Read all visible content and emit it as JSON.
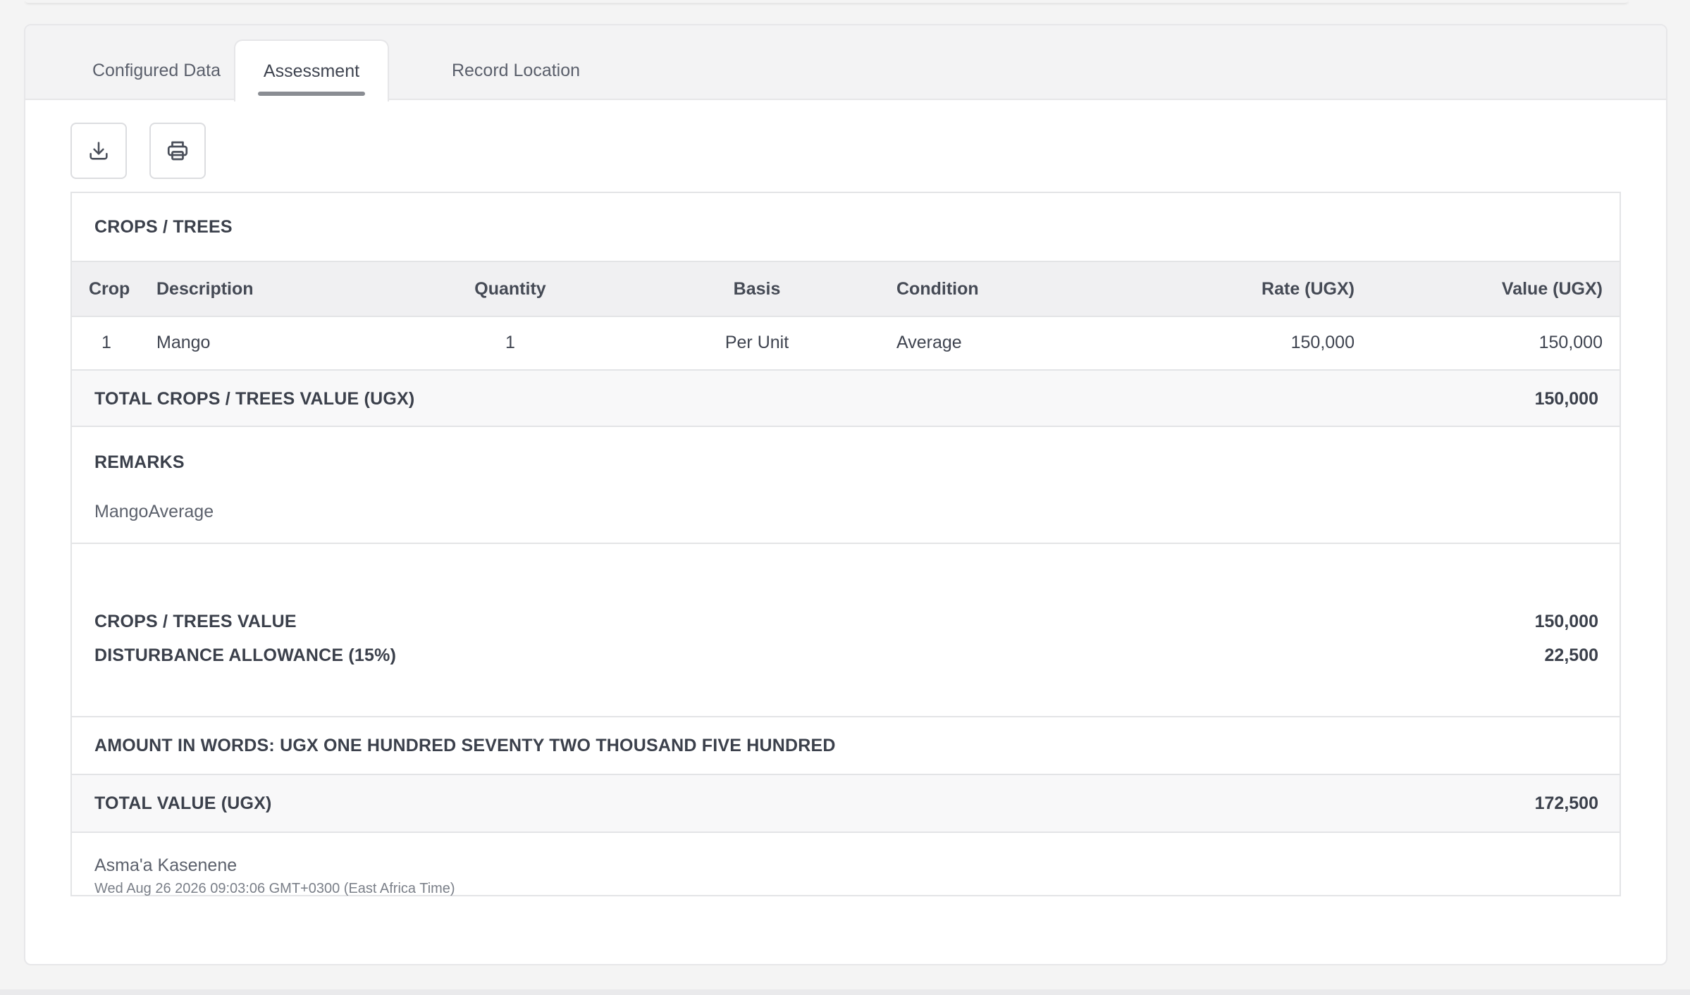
{
  "tabs": [
    {
      "label": "Configured Data",
      "active": false
    },
    {
      "label": "Assessment",
      "active": true
    },
    {
      "label": "Record Location",
      "active": false
    }
  ],
  "toolbar": {
    "download_icon": "download-icon",
    "print_icon": "printer-icon"
  },
  "report": {
    "section_title": "CROPS / TREES",
    "columns": {
      "crop": "Crop",
      "description": "Description",
      "quantity": "Quantity",
      "basis": "Basis",
      "condition": "Condition",
      "rate": "Rate (UGX)",
      "value": "Value (UGX)"
    },
    "rows": [
      {
        "crop": "1",
        "description": "Mango",
        "quantity": "1",
        "basis": "Per Unit",
        "condition": "Average",
        "rate": "150,000",
        "value": "150,000"
      }
    ],
    "total_crops_label": "TOTAL CROPS / TREES VALUE (UGX)",
    "total_crops_value": "150,000",
    "remarks_label": "REMARKS",
    "remarks_text": "MangoAverage",
    "crops_value_label": "CROPS / TREES VALUE",
    "crops_value": "150,000",
    "disturbance_label": "DISTURBANCE ALLOWANCE (15%)",
    "disturbance_value": "22,500",
    "amount_in_words": "AMOUNT IN WORDS: UGX ONE HUNDRED SEVENTY TWO THOUSAND FIVE HUNDRED",
    "total_value_label": "TOTAL VALUE (UGX)",
    "total_value": "172,500",
    "signer": "Asma'a Kasenene",
    "signed_at": "Wed Aug 26 2026 09:03:06 GMT+0300 (East Africa Time)"
  },
  "colors": {
    "background": "#f4f4f4",
    "card": "#ffffff",
    "border": "#e3e4e6",
    "header_band": "#f0f0f2",
    "text": "#3f4450",
    "tab_underline": "#8a8d93"
  }
}
